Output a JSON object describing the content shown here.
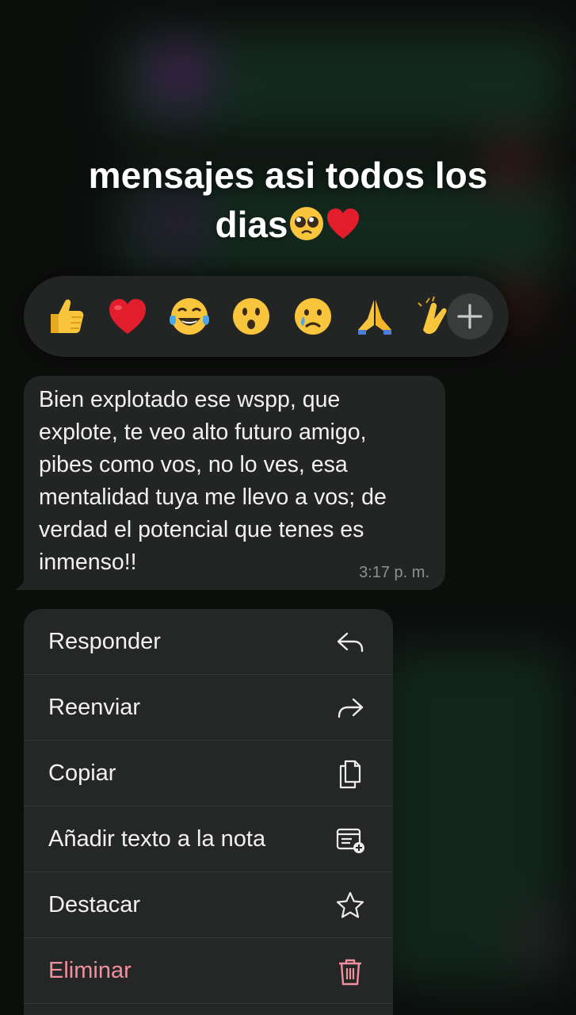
{
  "caption": {
    "line1": "mensajes asi todos los",
    "line2": "dias",
    "emoji1": "pleading-face",
    "emoji2": "red-heart"
  },
  "reactions": [
    {
      "name": "thumbs-up",
      "glyph": "👍"
    },
    {
      "name": "red-heart",
      "glyph": "❤️"
    },
    {
      "name": "tears-of-joy",
      "glyph": "😂"
    },
    {
      "name": "surprised-face",
      "glyph": "😮"
    },
    {
      "name": "crying-face",
      "glyph": "😢"
    },
    {
      "name": "folded-hands",
      "glyph": "🙏"
    },
    {
      "name": "clapping-hands",
      "glyph": "👏"
    }
  ],
  "message": {
    "text": "Bien explotado ese wspp, que\nexplote, te veo alto futuro amigo,\npibes como vos, no lo ves, esa\nmentalidad tuya me llevo a vos; de\nverdad el potencial que tenes es\ninmenso!!",
    "time": "3:17 p. m."
  },
  "menu": {
    "items": [
      {
        "label": "Responder",
        "icon": "reply-icon"
      },
      {
        "label": "Reenviar",
        "icon": "forward-icon"
      },
      {
        "label": "Copiar",
        "icon": "copy-icon"
      },
      {
        "label": "Añadir texto a la nota",
        "icon": "add-note-icon"
      },
      {
        "label": "Destacar",
        "icon": "star-icon"
      },
      {
        "label": "Eliminar",
        "icon": "trash-icon"
      }
    ]
  },
  "colors": {
    "danger": "#f28f9e",
    "bubble": "#232524",
    "menu": "#252726"
  }
}
